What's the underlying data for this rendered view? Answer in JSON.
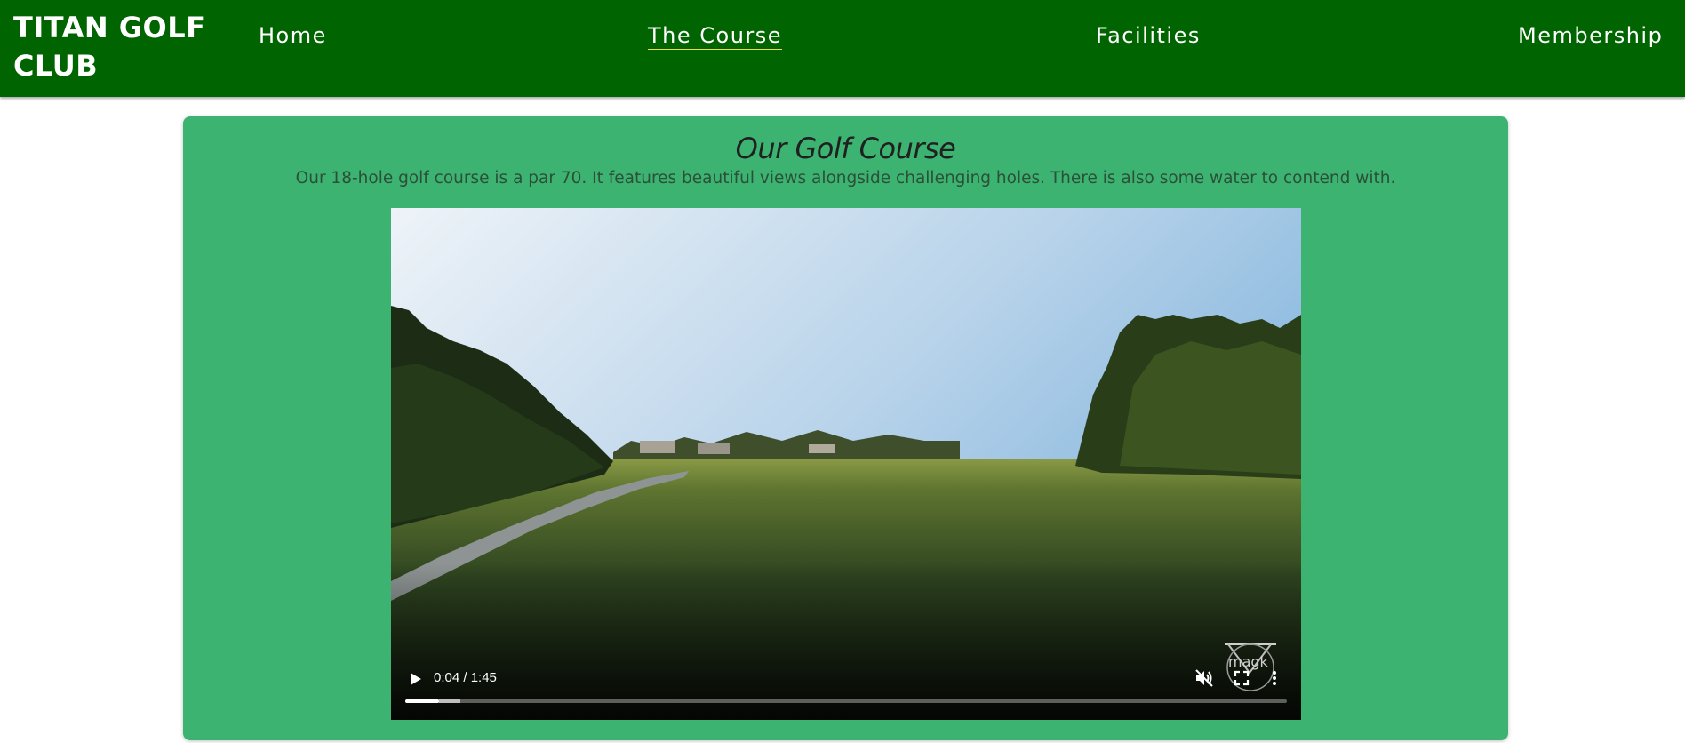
{
  "navbar": {
    "brand": "TITAN GOLF CLUB",
    "links": [
      {
        "label": "Home",
        "active": false
      },
      {
        "label": "The Course",
        "active": true
      },
      {
        "label": "Facilities",
        "active": false
      },
      {
        "label": "Membership",
        "active": false
      }
    ]
  },
  "section": {
    "title": "Our Golf Course",
    "description": "Our 18-hole golf course is a par 70. It features beautiful views alongside challenging holes. There is also some water to contend with."
  },
  "video": {
    "time": "0:04 / 1:45",
    "played_fraction": 0.038,
    "buffered_fraction": 0.063,
    "muted": true,
    "watermark_text": "magk"
  },
  "colors": {
    "nav_bg": "#006400",
    "card_bg": "#3cb371",
    "active_underline": "#f2d94e"
  }
}
